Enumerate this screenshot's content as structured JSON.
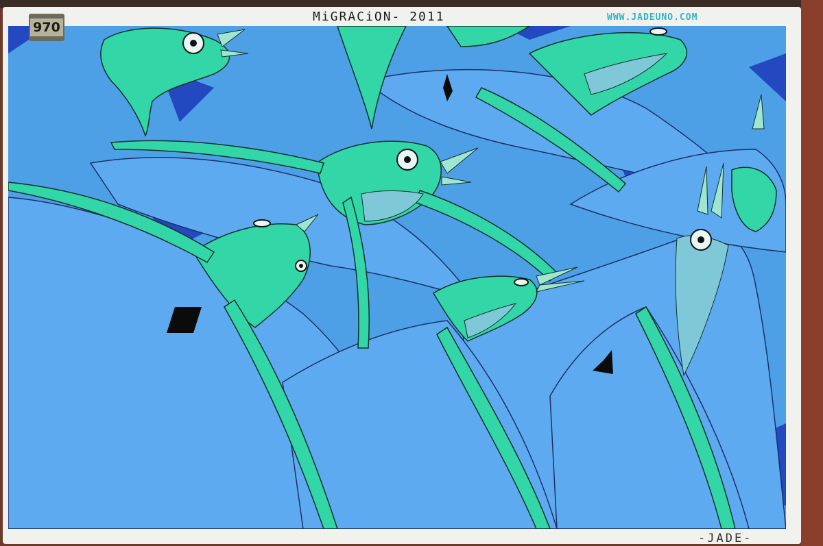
{
  "photo": {
    "plaque_number": "970",
    "title": "MiGRACiON- 2011",
    "website": "WWW.JADEUNO.COM",
    "signature": "-JADE-"
  },
  "colors": {
    "sky_blue": "#4d9fe6",
    "deep_blue": "#1f3fb0",
    "bird_blue": "#5aa8ee",
    "teal": "#2ed3a0",
    "frame_white": "#f1f1ee",
    "wall_brick": "#8a3f2c"
  }
}
